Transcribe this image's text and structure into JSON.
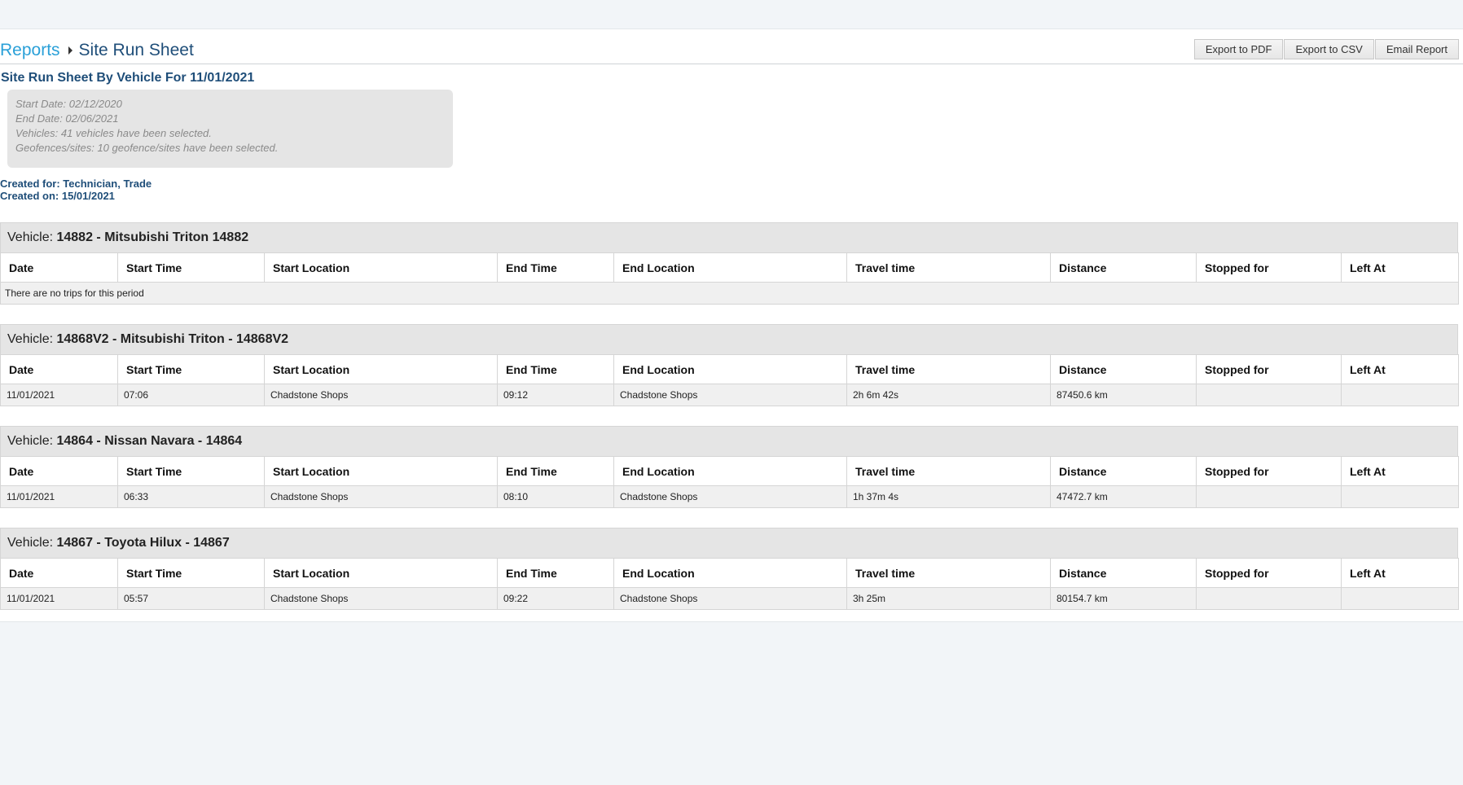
{
  "breadcrumb": {
    "root": "Reports",
    "current": "Site Run Sheet"
  },
  "actions": {
    "pdf": "Export to PDF",
    "csv": "Export to CSV",
    "email": "Email Report"
  },
  "report": {
    "title": "Site Run Sheet By Vehicle For 11/01/2021",
    "criteria": [
      "Start Date: 02/12/2020",
      "End Date: 02/06/2021",
      "Vehicles: 41 vehicles have been selected.",
      "Geofences/sites: 10 geofence/sites have been selected."
    ],
    "created_for": "Created for: Technician, Trade",
    "created_on": "Created on: 15/01/2021"
  },
  "vehicle_prefix": "Vehicle: ",
  "columns": [
    "Date",
    "Start Time",
    "Start Location",
    "End Time",
    "End Location",
    "Travel time",
    "Distance",
    "Stopped for",
    "Left At"
  ],
  "empty_message": "There are no trips for this period",
  "vehicles": [
    {
      "name": "14882 - Mitsubishi Triton 14882",
      "rows": []
    },
    {
      "name": "14868V2 - Mitsubishi Triton - 14868V2",
      "rows": [
        [
          "11/01/2021",
          "07:06",
          "Chadstone Shops",
          "09:12",
          "Chadstone Shops",
          "2h 6m 42s",
          "87450.6 km",
          "",
          ""
        ]
      ]
    },
    {
      "name": "14864 - Nissan Navara - 14864",
      "rows": [
        [
          "11/01/2021",
          "06:33",
          "Chadstone Shops",
          "08:10",
          "Chadstone Shops",
          "1h 37m 4s",
          "47472.7 km",
          "",
          ""
        ]
      ]
    },
    {
      "name": "14867 - Toyota Hilux - 14867",
      "rows": [
        [
          "11/01/2021",
          "05:57",
          "Chadstone Shops",
          "09:22",
          "Chadstone Shops",
          "3h 25m",
          "80154.7 km",
          "",
          ""
        ]
      ]
    }
  ]
}
